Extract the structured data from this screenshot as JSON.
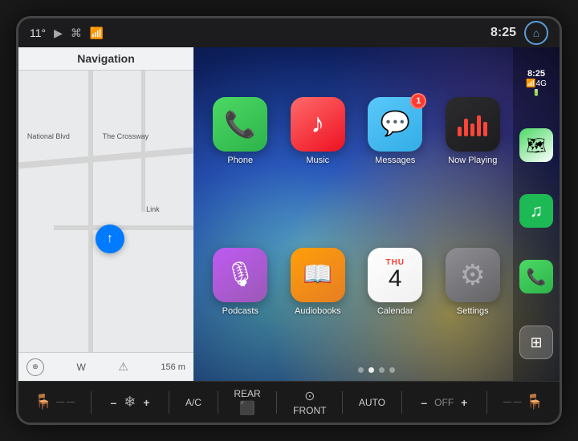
{
  "status_bar": {
    "temperature": "11°",
    "time": "8:25",
    "home_label": "⌂"
  },
  "nav_panel": {
    "title": "Navigation",
    "road1": "National Blvd",
    "road2": "The Crossway",
    "road3": "Link",
    "direction": "W",
    "distance": "156 m"
  },
  "carplay": {
    "apps": [
      {
        "id": "phone",
        "label": "Phone",
        "icon_type": "phone",
        "badge": null
      },
      {
        "id": "music",
        "label": "Music",
        "icon_type": "music",
        "badge": null
      },
      {
        "id": "messages",
        "label": "Messages",
        "icon_type": "messages",
        "badge": "1"
      },
      {
        "id": "nowplaying",
        "label": "Now Playing",
        "icon_type": "nowplaying",
        "badge": null
      },
      {
        "id": "podcasts",
        "label": "Podcasts",
        "icon_type": "podcasts",
        "badge": null
      },
      {
        "id": "audiobooks",
        "label": "Audiobooks",
        "icon_type": "audiobooks",
        "badge": null
      },
      {
        "id": "calendar",
        "label": "Calendar",
        "icon_type": "calendar",
        "badge": null,
        "cal_day": "4",
        "cal_month": "THU"
      },
      {
        "id": "settings",
        "label": "Settings",
        "icon_type": "settings",
        "badge": null
      }
    ],
    "page_dots": [
      false,
      true,
      false,
      false
    ],
    "dock": {
      "time": "8:25",
      "signal": "📶4G"
    }
  },
  "controls": {
    "seat_label": "seat",
    "minus1": "–",
    "fan_label": "fan",
    "plus1": "+",
    "ac_label": "A/C",
    "rear_label": "REAR",
    "rear_sub": "rear-heat",
    "front_label": "FRONT",
    "front_sub": "front-vent",
    "auto_label": "AUTO",
    "minus2": "–",
    "off_label": "OFF",
    "plus2": "+",
    "seat2_label": "seat"
  }
}
